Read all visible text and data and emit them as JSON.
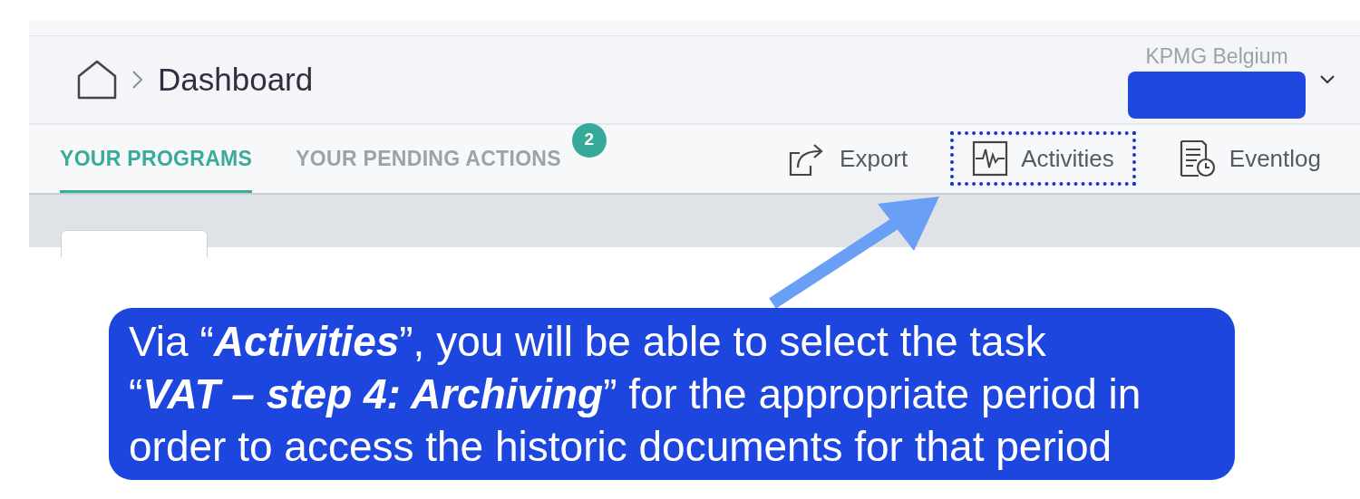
{
  "breadcrumb": {
    "current": "Dashboard"
  },
  "account": {
    "organization": "KPMG Belgium",
    "name_redacted": true
  },
  "tabs": [
    {
      "label": "YOUR PROGRAMS",
      "selected": true
    },
    {
      "label": "YOUR PENDING ACTIONS",
      "selected": false,
      "badge": "2"
    }
  ],
  "actions": [
    {
      "label": "Export",
      "highlighted": false
    },
    {
      "label": "Activities",
      "highlighted": true
    },
    {
      "label": "Eventlog",
      "highlighted": false
    }
  ],
  "callout": {
    "text": "Via “**Activities**”, you will be able to select the task\n“**VAT – step 4: Archiving**” for the appropriate period in\norder to access the historic documents for that period"
  }
}
